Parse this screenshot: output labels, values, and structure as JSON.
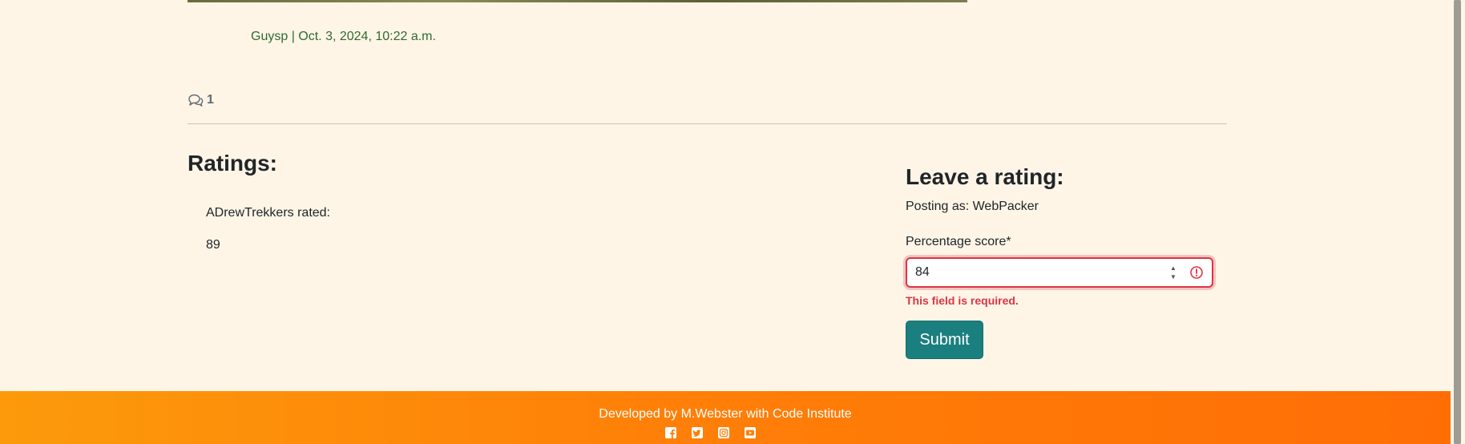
{
  "post": {
    "byline": "Guysp | Oct. 3, 2024, 10:22 a.m.",
    "comment_count": "1"
  },
  "ratings": {
    "heading": "Ratings:",
    "items": [
      {
        "author_line": "ADrewTrekkers rated:",
        "score": "89"
      }
    ]
  },
  "rating_form": {
    "heading": "Leave a rating:",
    "posting_as": "Posting as: WebPacker",
    "score_label": "Percentage score*",
    "score_value": "84",
    "error_message": "This field is required.",
    "submit_label": "Submit"
  },
  "footer": {
    "credit": "Developed by M.Webster with Code Institute",
    "social_icons": [
      "facebook-icon",
      "twitter-icon",
      "instagram-icon",
      "youtube-icon"
    ]
  },
  "colors": {
    "background": "#fef5e7",
    "byline": "#2f6b2f",
    "error": "#dc3545",
    "submit_button": "#1b7f7f",
    "footer_start": "#fc9a0b",
    "footer_end": "#ff6e05"
  }
}
